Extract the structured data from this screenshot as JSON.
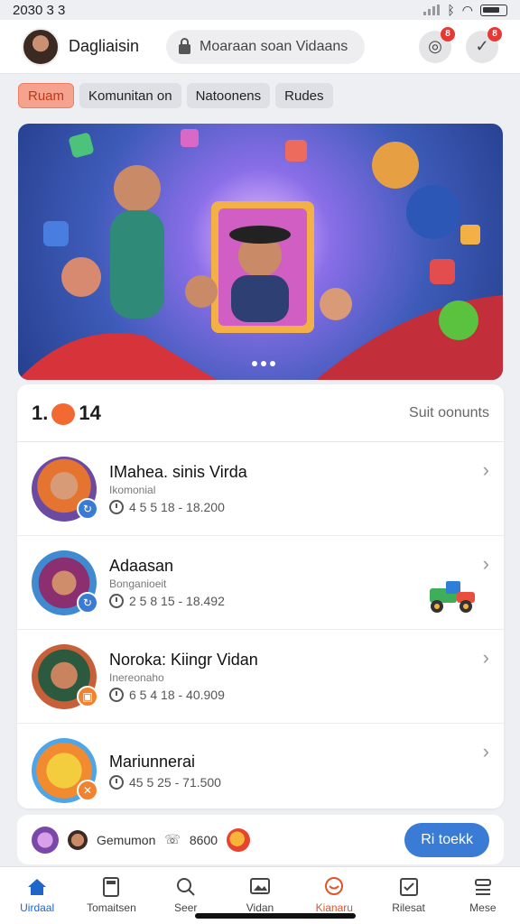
{
  "status_bar": {
    "time": "2030 3 3"
  },
  "header": {
    "user_name": "Dagliaisin",
    "search_placeholder": "Moaraan soan Vidaans",
    "notif_badge_1": "8",
    "notif_badge_2": "8"
  },
  "chips": [
    {
      "label": "Ruam",
      "active": true
    },
    {
      "label": "Komunitan on",
      "active": false
    },
    {
      "label": "Natoonens",
      "active": false
    },
    {
      "label": "Rudes",
      "active": false
    }
  ],
  "hero": {
    "page_dots": 3,
    "active_dot": 1
  },
  "list": {
    "count_left": "1.",
    "count_right": "14",
    "sort_label": "Suit oonunts",
    "items": [
      {
        "title": "IMahea. sinis Virda",
        "subtitle": "Ikomonial",
        "meta": "4 5 5 18 - 18.200",
        "avatar_color": "#7b4a9e",
        "badge_color": "#3a7bd5"
      },
      {
        "title": "Adaasan",
        "subtitle": "Bonganioeit",
        "meta": "2 5 8 15 - 18.492",
        "avatar_color": "#2f8c7a",
        "badge_color": "#3a7bd5"
      },
      {
        "title": "Noroka: Kiingr Vidan",
        "subtitle": "Inereonaho",
        "meta": "6 5 4 18 - 40.909",
        "avatar_color": "#c7603a",
        "badge_color": "#f0832f"
      },
      {
        "title": "Mariunnerai",
        "subtitle": "",
        "meta": "45 5 25 - 71.500",
        "avatar_color": "#f2c84b",
        "badge_color": "#f0832f"
      }
    ]
  },
  "mini_bar": {
    "label": "Gemumon",
    "phone_value": "8600",
    "cta_label": "Ri toekk"
  },
  "tabs": [
    {
      "label": "Uirdaal",
      "icon": "home-icon",
      "state": "active"
    },
    {
      "label": "Tomaitsen",
      "icon": "calculator-icon",
      "state": ""
    },
    {
      "label": "Seer",
      "icon": "search-icon",
      "state": ""
    },
    {
      "label": "Vidan",
      "icon": "image-icon",
      "state": ""
    },
    {
      "label": "Kianaru",
      "icon": "chat-icon",
      "state": "hot"
    },
    {
      "label": "Rilesat",
      "icon": "checkbox-icon",
      "state": ""
    },
    {
      "label": "Mese",
      "icon": "menu-icon",
      "state": ""
    }
  ]
}
